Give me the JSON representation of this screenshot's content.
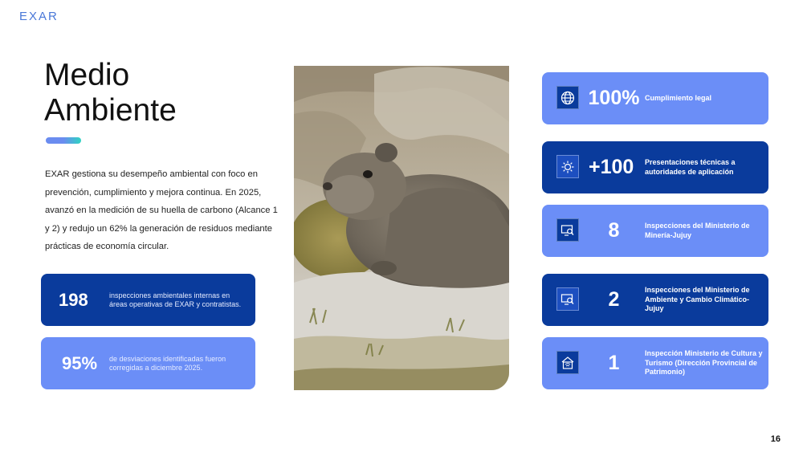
{
  "brand": {
    "logo_text": "EXAR",
    "color": "#4a78d8"
  },
  "title": {
    "line1": "Medio",
    "line2": "Ambiente"
  },
  "intro": "EXAR gestiona su desempeño ambiental con foco en prevención, cumplimiento y mejora continua. En 2025, avanzó en la medición de su huella de carbono (Alcance 1 y 2) y redujo un 62% la generación de residuos mediante prácticas de economía circular.",
  "stats": [
    {
      "value": "198",
      "description": "inspecciones ambientales internas en áreas operativas de EXAR y contratistas."
    },
    {
      "value": "95%",
      "description": "de desviaciones identificadas fueron corregidas a diciembre 2025."
    }
  ],
  "kpis": [
    {
      "icon": "globe-icon",
      "value": "100%",
      "label": "Cumplimiento legal"
    },
    {
      "icon": "gear-network-icon",
      "value": "+100",
      "label": "Presentaciones técnicas a autoridades de aplicación"
    },
    {
      "icon": "inspection-monitor-icon",
      "value": "8",
      "label": "Inspecciones del Ministerio de Minería-Jujuy"
    },
    {
      "icon": "inspection-monitor-icon",
      "value": "2",
      "label": "Inspecciones del Ministerio de Ambiente y Cambio Climático-Jujuy"
    },
    {
      "icon": "heritage-house-icon",
      "value": "1",
      "label": "Inspección Ministerio de Cultura y Turismo (Dirección Provincial de Patrimonio)"
    }
  ],
  "colors": {
    "dark_blue": "#0a3b9c",
    "light_blue": "#6b8ef7",
    "teal": "#2fd4c2"
  },
  "page_number": "16"
}
